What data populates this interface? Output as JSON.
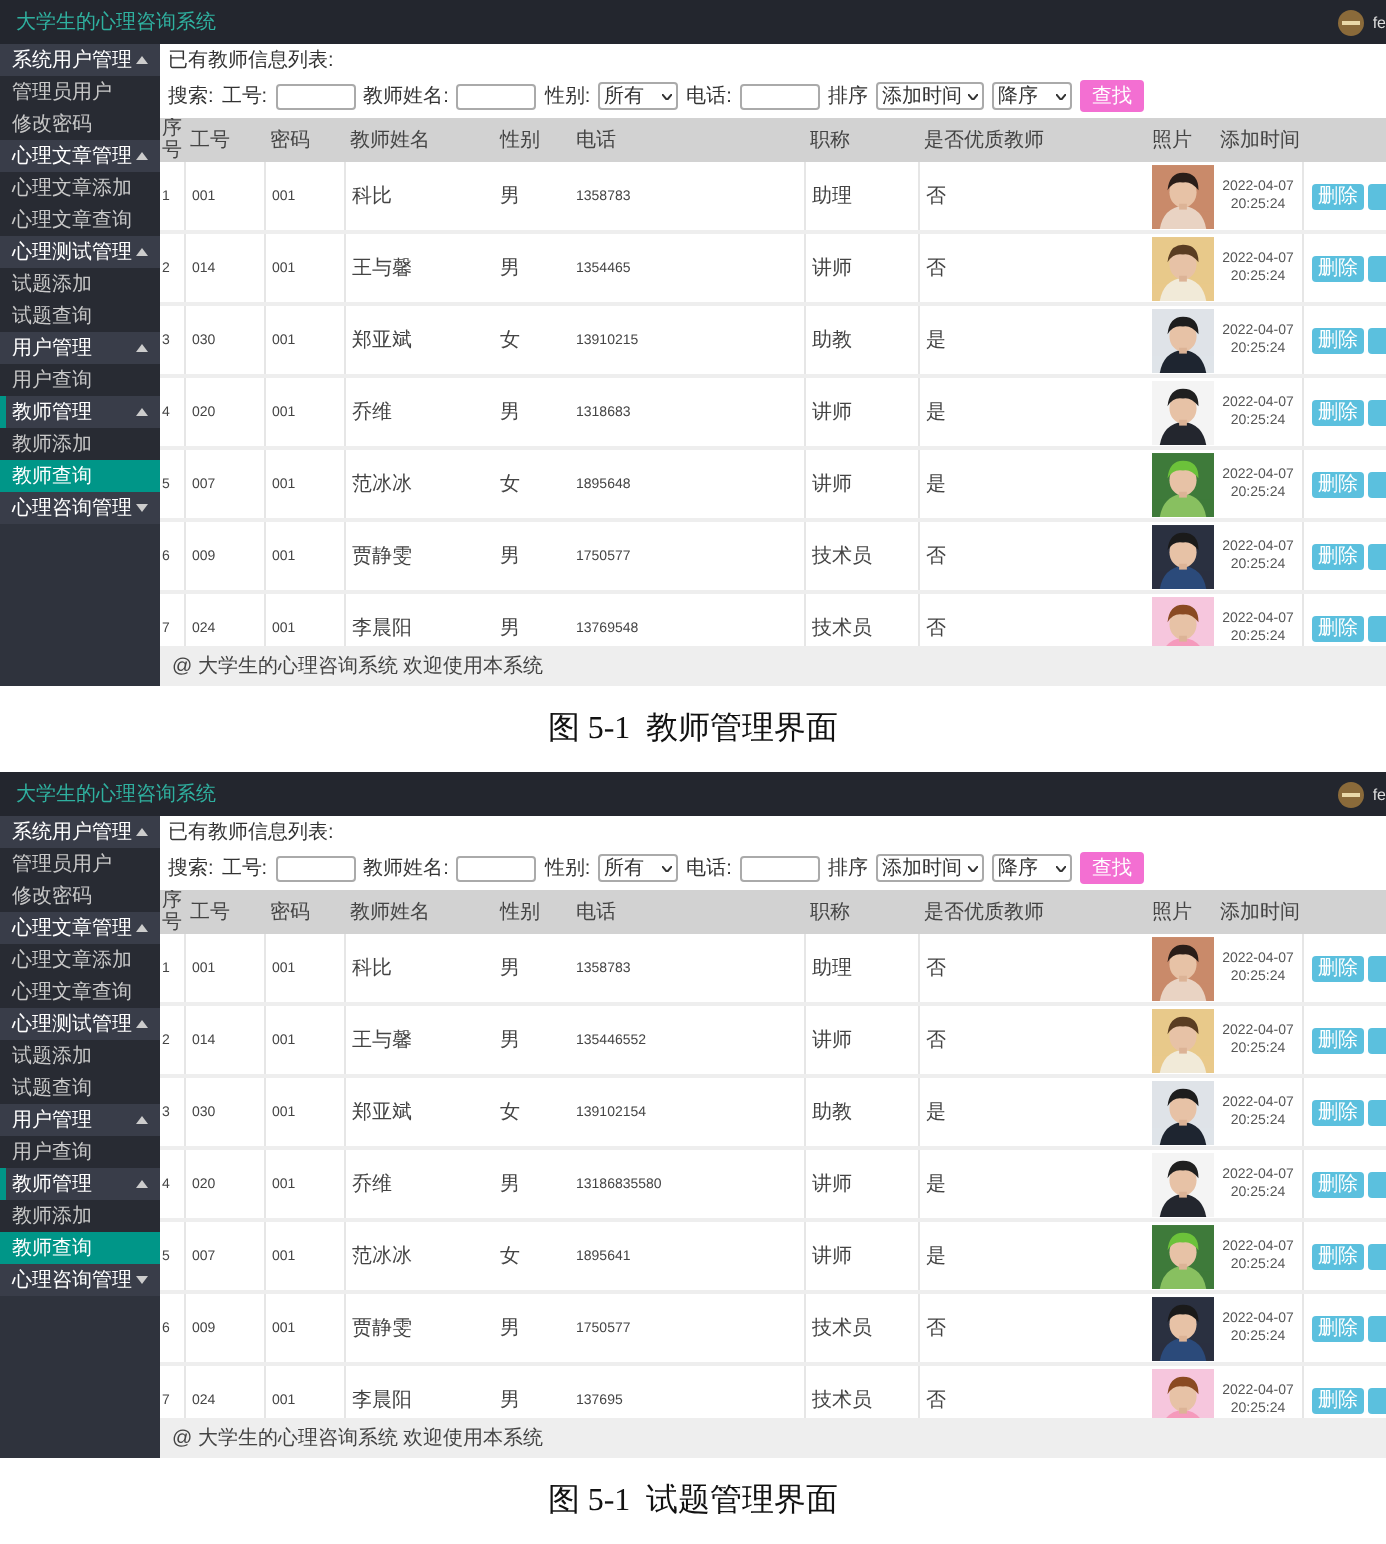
{
  "figures": [
    {
      "screen": {
        "app_title": "大学生的心理咨询系统",
        "user_name": "fe",
        "sidebar": {
          "groups": [
            {
              "label": "系统用户管理",
              "expanded": true,
              "active": false,
              "items": [
                {
                  "label": "管理员用户",
                  "selected": false
                },
                {
                  "label": "修改密码",
                  "selected": false
                }
              ]
            },
            {
              "label": "心理文章管理",
              "expanded": true,
              "active": false,
              "items": [
                {
                  "label": "心理文章添加",
                  "selected": false
                },
                {
                  "label": "心理文章查询",
                  "selected": false
                }
              ]
            },
            {
              "label": "心理测试管理",
              "expanded": true,
              "active": false,
              "items": [
                {
                  "label": "试题添加",
                  "selected": false
                },
                {
                  "label": "试题查询",
                  "selected": false
                }
              ]
            },
            {
              "label": "用户管理",
              "expanded": true,
              "active": false,
              "items": [
                {
                  "label": "用户查询",
                  "selected": false
                }
              ]
            },
            {
              "label": "教师管理",
              "expanded": true,
              "active": true,
              "items": [
                {
                  "label": "教师添加",
                  "selected": false
                },
                {
                  "label": "教师查询",
                  "selected": true
                }
              ]
            },
            {
              "label": "心理咨询管理",
              "expanded": false,
              "active": false
            }
          ]
        },
        "list_title": "已有教师信息列表:",
        "search": [
          {
            "kind": "label",
            "text": "搜索:"
          },
          {
            "kind": "label",
            "text": "工号:"
          },
          {
            "kind": "input"
          },
          {
            "kind": "label",
            "text": "教师姓名:"
          },
          {
            "kind": "input"
          },
          {
            "kind": "label",
            "text": "性别:"
          },
          {
            "kind": "select",
            "value": "所有"
          },
          {
            "kind": "label",
            "text": "电话:"
          },
          {
            "kind": "input"
          },
          {
            "kind": "label",
            "text": "排序"
          },
          {
            "kind": "select",
            "value": "添加时间"
          },
          {
            "kind": "select",
            "value": "降序"
          },
          {
            "kind": "button",
            "text": "查找"
          }
        ],
        "table": {
          "columns": [
            "序号",
            "工号",
            "密码",
            "教师姓名",
            "性别",
            "电话",
            "职称",
            "是否优质教师",
            "照片",
            "添加时间"
          ],
          "rows": [
            {
              "cells": [
                "1",
                "001",
                "001",
                "科比",
                "男",
                "1358783",
                "助理",
                "否"
              ],
              "time": "2022-04-07 20:25:24",
              "actions": [
                {
                  "kind": "delete",
                  "label": "删除"
                },
                {
                  "kind": "edit"
                }
              ]
            },
            {
              "cells": [
                "2",
                "014",
                "001",
                "王与馨",
                "男",
                "1354465",
                "讲师",
                "否"
              ],
              "time": "2022-04-07 20:25:24",
              "actions": [
                {
                  "kind": "delete",
                  "label": "删除"
                },
                {
                  "kind": "edit"
                }
              ]
            },
            {
              "cells": [
                "3",
                "030",
                "001",
                "郑亚斌",
                "女",
                "13910215",
                "助教",
                "是"
              ],
              "time": "2022-04-07 20:25:24",
              "actions": [
                {
                  "kind": "delete",
                  "label": "删除"
                },
                {
                  "kind": "edit"
                }
              ]
            },
            {
              "cells": [
                "4",
                "020",
                "001",
                "乔维",
                "男",
                "1318683",
                "讲师",
                "是"
              ],
              "time": "2022-04-07 20:25:24",
              "actions": [
                {
                  "kind": "delete",
                  "label": "删除"
                },
                {
                  "kind": "edit"
                }
              ]
            },
            {
              "cells": [
                "5",
                "007",
                "001",
                "范冰冰",
                "女",
                "1895648",
                "讲师",
                "是"
              ],
              "time": "2022-04-07 20:25:24",
              "actions": [
                {
                  "kind": "delete",
                  "label": "删除"
                },
                {
                  "kind": "edit"
                }
              ]
            },
            {
              "cells": [
                "6",
                "009",
                "001",
                "贾静雯",
                "男",
                "1750577",
                "技术员",
                "否"
              ],
              "time": "2022-04-07 20:25:24",
              "actions": [
                {
                  "kind": "delete",
                  "label": "删除"
                },
                {
                  "kind": "edit"
                }
              ]
            },
            {
              "cells": [
                "7",
                "024",
                "001",
                "李晨阳",
                "男",
                "13769548",
                "技术员",
                "否"
              ],
              "time": "2022-04-07 20:25:24",
              "actions": [
                {
                  "kind": "delete",
                  "label": "删除"
                },
                {
                  "kind": "edit"
                }
              ]
            }
          ]
        },
        "footer": "@ 大学生的心理咨询系统 欢迎使用本系统"
      },
      "caption": "图 5-1  教师管理界面"
    },
    {
      "screen": {
        "app_title": "大学生的心理咨询系统",
        "user_name": "fe",
        "sidebar": {
          "groups": [
            {
              "label": "系统用户管理",
              "expanded": true,
              "active": false,
              "items": [
                {
                  "label": "管理员用户",
                  "selected": false
                },
                {
                  "label": "修改密码",
                  "selected": false
                }
              ]
            },
            {
              "label": "心理文章管理",
              "expanded": true,
              "active": false,
              "items": [
                {
                  "label": "心理文章添加",
                  "selected": false
                },
                {
                  "label": "心理文章查询",
                  "selected": false
                }
              ]
            },
            {
              "label": "心理测试管理",
              "expanded": true,
              "active": false,
              "items": [
                {
                  "label": "试题添加",
                  "selected": false
                },
                {
                  "label": "试题查询",
                  "selected": false
                }
              ]
            },
            {
              "label": "用户管理",
              "expanded": true,
              "active": false,
              "items": [
                {
                  "label": "用户查询",
                  "selected": false
                }
              ]
            },
            {
              "label": "教师管理",
              "expanded": true,
              "active": true,
              "items": [
                {
                  "label": "教师添加",
                  "selected": false
                },
                {
                  "label": "教师查询",
                  "selected": true
                }
              ]
            },
            {
              "label": "心理咨询管理",
              "expanded": false,
              "active": false
            }
          ]
        },
        "list_title": "已有教师信息列表:",
        "search": [
          {
            "kind": "label",
            "text": "搜索:"
          },
          {
            "kind": "label",
            "text": "工号:"
          },
          {
            "kind": "input"
          },
          {
            "kind": "label",
            "text": "教师姓名:"
          },
          {
            "kind": "input"
          },
          {
            "kind": "label",
            "text": "性别:"
          },
          {
            "kind": "select",
            "value": "所有"
          },
          {
            "kind": "label",
            "text": "电话:"
          },
          {
            "kind": "input"
          },
          {
            "kind": "label",
            "text": "排序"
          },
          {
            "kind": "select",
            "value": "添加时间"
          },
          {
            "kind": "select",
            "value": "降序"
          },
          {
            "kind": "button",
            "text": "查找"
          }
        ],
        "table": {
          "columns": [
            "序号",
            "工号",
            "密码",
            "教师姓名",
            "性别",
            "电话",
            "职称",
            "是否优质教师",
            "照片",
            "添加时间"
          ],
          "rows": [
            {
              "cells": [
                "1",
                "001",
                "001",
                "科比",
                "男",
                "1358783",
                "助理",
                "否"
              ],
              "time": "2022-04-07 20:25:24",
              "actions": [
                {
                  "kind": "delete",
                  "label": "删除"
                },
                {
                  "kind": "edit"
                }
              ]
            },
            {
              "cells": [
                "2",
                "014",
                "001",
                "王与馨",
                "男",
                "135446552",
                "讲师",
                "否"
              ],
              "time": "2022-04-07 20:25:24",
              "actions": [
                {
                  "kind": "delete",
                  "label": "删除"
                },
                {
                  "kind": "edit"
                }
              ]
            },
            {
              "cells": [
                "3",
                "030",
                "001",
                "郑亚斌",
                "女",
                "139102154",
                "助教",
                "是"
              ],
              "time": "2022-04-07 20:25:24",
              "actions": [
                {
                  "kind": "delete",
                  "label": "删除"
                },
                {
                  "kind": "edit"
                }
              ]
            },
            {
              "cells": [
                "4",
                "020",
                "001",
                "乔维",
                "男",
                "13186835580",
                "讲师",
                "是"
              ],
              "time": "2022-04-07 20:25:24",
              "actions": [
                {
                  "kind": "delete",
                  "label": "删除"
                },
                {
                  "kind": "edit"
                }
              ]
            },
            {
              "cells": [
                "5",
                "007",
                "001",
                "范冰冰",
                "女",
                "1895641",
                "讲师",
                "是"
              ],
              "time": "2022-04-07 20:25:24",
              "actions": [
                {
                  "kind": "delete",
                  "label": "删除"
                },
                {
                  "kind": "edit"
                }
              ]
            },
            {
              "cells": [
                "6",
                "009",
                "001",
                "贾静雯",
                "男",
                "1750577",
                "技术员",
                "否"
              ],
              "time": "2022-04-07 20:25:24",
              "actions": [
                {
                  "kind": "delete",
                  "label": "删除"
                },
                {
                  "kind": "edit"
                }
              ]
            },
            {
              "cells": [
                "7",
                "024",
                "001",
                "李晨阳",
                "男",
                "137695",
                "技术员",
                "否"
              ],
              "time": "2022-04-07 20:25:24",
              "actions": [
                {
                  "kind": "delete",
                  "label": "删除"
                },
                {
                  "kind": "edit"
                }
              ]
            }
          ]
        },
        "footer": "@ 大学生的心理咨询系统 欢迎使用本系统"
      },
      "caption": "图 5-1  试题管理界面"
    }
  ]
}
